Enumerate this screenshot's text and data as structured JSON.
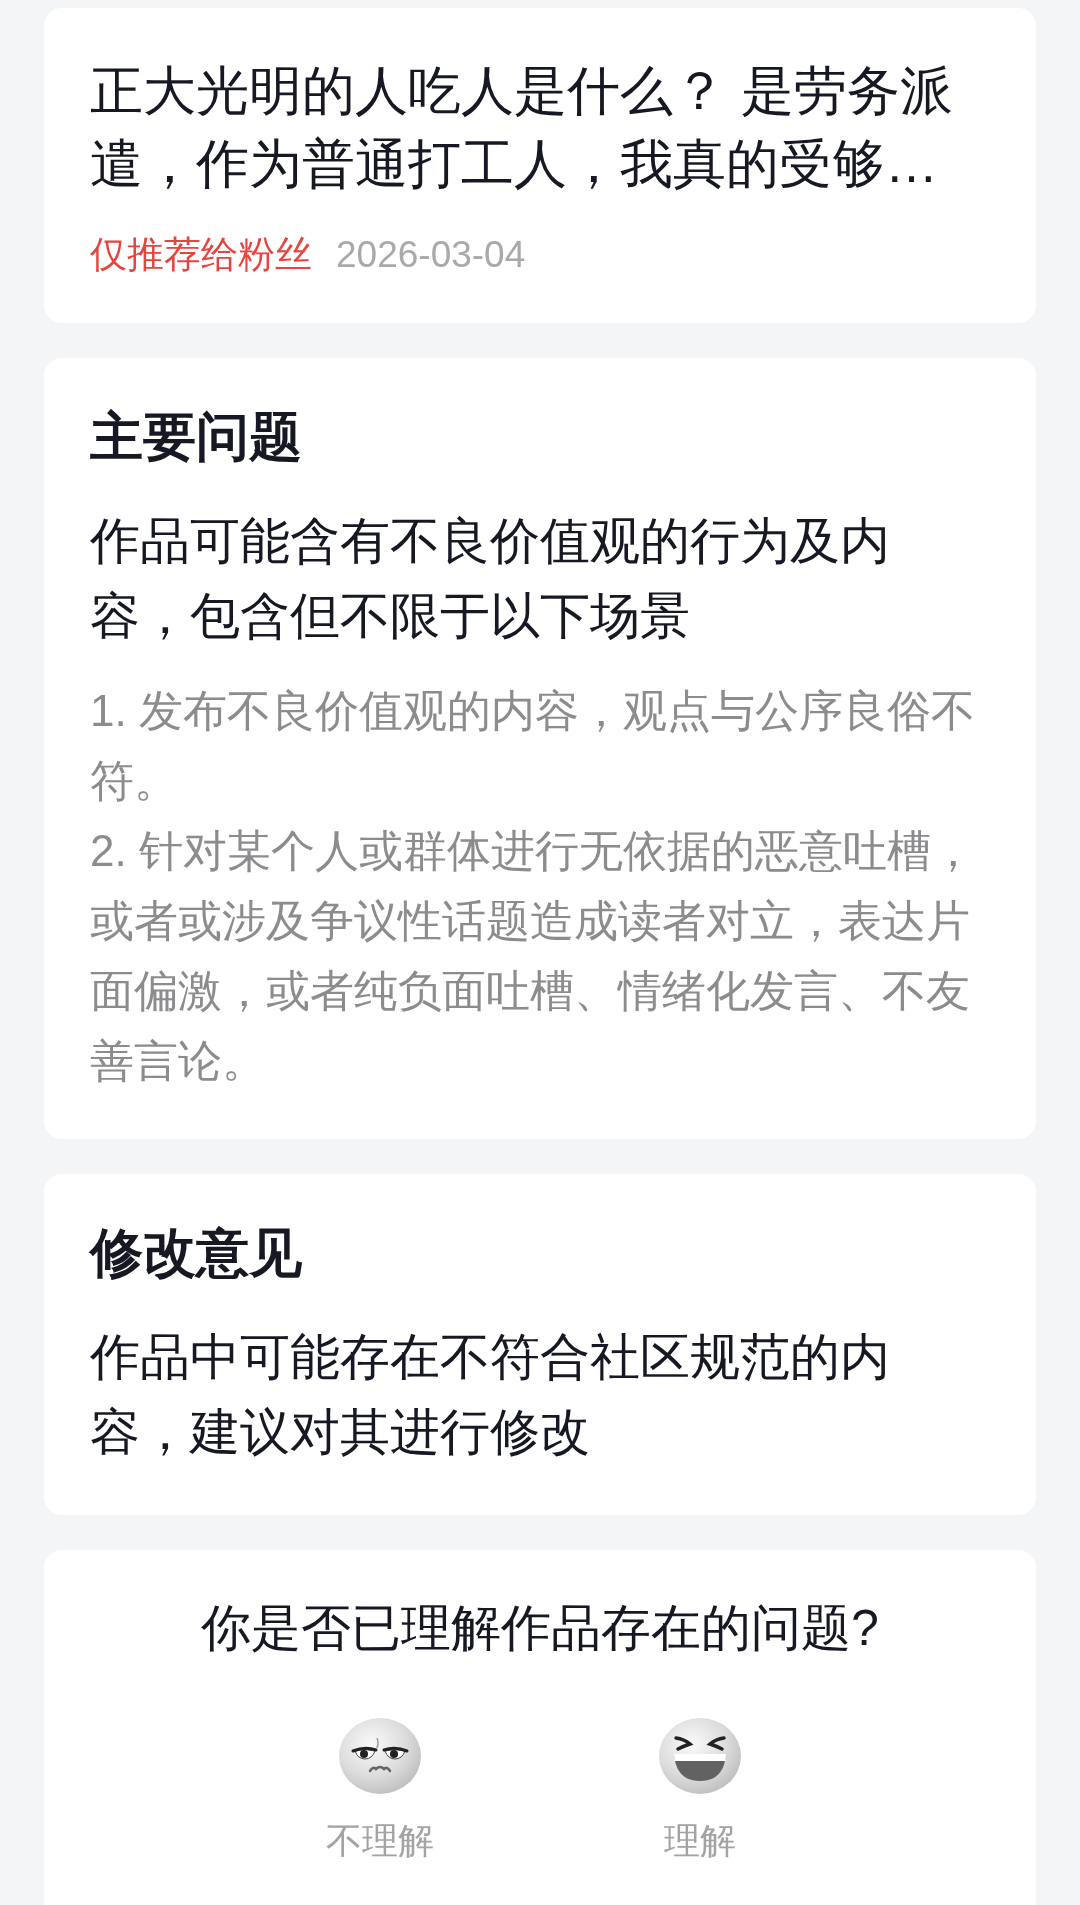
{
  "work": {
    "title": "正大光明的人吃人是什么？ 是劳务派遣，作为普通打工人，我真的受够…",
    "visibility": "仅推荐给粉丝",
    "date": "2026-03-04"
  },
  "main_issue": {
    "heading": "主要问题",
    "summary": "作品可能含有不良价值观的行为及内容，包含但不限于以下场景",
    "items": [
      "1. 发布不良价值观的内容，观点与公序良俗不符。",
      "2. 针对某个人或群体进行无依据的恶意吐槽，或者或涉及争议性话题造成读者对立，表达片面偏激，或者纯负面吐槽、情绪化发言、不友善言论。"
    ]
  },
  "suggestion": {
    "heading": "修改意见",
    "text": "作品中可能存在不符合社区规范的内容，建议对其进行修改"
  },
  "feedback": {
    "question": "你是否已理解作品存在的问题?",
    "options": [
      {
        "kind": "annoyed",
        "label": "不理解",
        "selected": false
      },
      {
        "kind": "laughing",
        "label": "理解",
        "selected": false
      }
    ]
  }
}
